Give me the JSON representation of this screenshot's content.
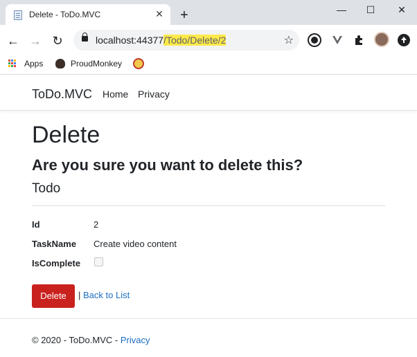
{
  "browser": {
    "tab_title": "Delete - ToDo.MVC",
    "url_host": "localhost:44377",
    "url_path": "/Todo/Delete/2",
    "bookmarks": [
      "Apps",
      "ProudMonkey"
    ]
  },
  "site": {
    "brand": "ToDo.MVC",
    "nav": [
      "Home",
      "Privacy"
    ]
  },
  "page": {
    "title": "Delete",
    "confirm": "Are you sure you want to delete this?",
    "entity": "Todo",
    "fields": [
      {
        "label": "Id",
        "value": "2"
      },
      {
        "label": "TaskName",
        "value": "Create video content"
      },
      {
        "label": "IsComplete",
        "checked": false
      }
    ],
    "delete_label": "Delete",
    "separator": "|",
    "back_label": "Back to List"
  },
  "footer": {
    "copyright": "© 2020 - ToDo.MVC - ",
    "privacy": "Privacy"
  },
  "colors": {
    "danger": "#c9211e",
    "link": "#1b6ec2",
    "url_highlight": "#fde94a"
  }
}
